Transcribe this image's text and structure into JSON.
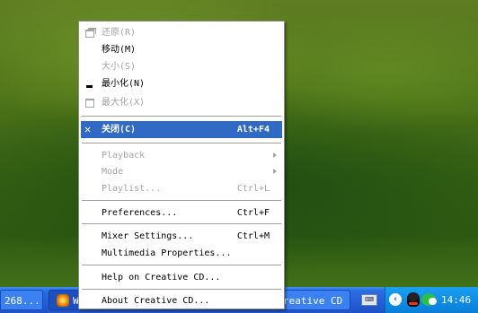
{
  "colors": {
    "menu_highlight": "#316ac5",
    "disabled_text": "#a3a3a3",
    "taskbar": "#245dd7",
    "tray": "#0f8ee6"
  },
  "taskbar": {
    "left_button_text": "268...",
    "mid_button_text": "W",
    "right_button_text": "reative CD",
    "keyboard_icon": "keyboard-icon",
    "clock": "14:46"
  },
  "menu": {
    "items": [
      {
        "label": "还原(R)",
        "shortcut": "",
        "disabled": true,
        "icon": "restore-icon"
      },
      {
        "label": "移动(M)",
        "shortcut": "",
        "disabled": false,
        "icon": ""
      },
      {
        "label": "大小(S)",
        "shortcut": "",
        "disabled": true,
        "icon": ""
      },
      {
        "label": "最小化(N)",
        "shortcut": "",
        "disabled": false,
        "icon": "minimize-icon"
      },
      {
        "label": "最大化(X)",
        "shortcut": "",
        "disabled": true,
        "icon": "maximize-icon"
      },
      {
        "label": "关闭(C)",
        "shortcut": "Alt+F4",
        "disabled": false,
        "highlighted": true,
        "icon": "close-icon"
      },
      {
        "label": "Playback",
        "shortcut": "",
        "disabled": true,
        "submenu": true
      },
      {
        "label": "Mode",
        "shortcut": "",
        "disabled": true,
        "submenu": true
      },
      {
        "label": "Playlist...",
        "shortcut": "Ctrl+L",
        "disabled": true
      },
      {
        "label": "Preferences...",
        "shortcut": "Ctrl+F",
        "disabled": false
      },
      {
        "label": "Mixer Settings...",
        "shortcut": "Ctrl+M",
        "disabled": false
      },
      {
        "label": "Multimedia Properties...",
        "shortcut": "",
        "disabled": false
      },
      {
        "label": "Help on Creative CD...",
        "shortcut": "",
        "disabled": false
      },
      {
        "label": "About Creative CD...",
        "shortcut": "",
        "disabled": false
      }
    ]
  }
}
